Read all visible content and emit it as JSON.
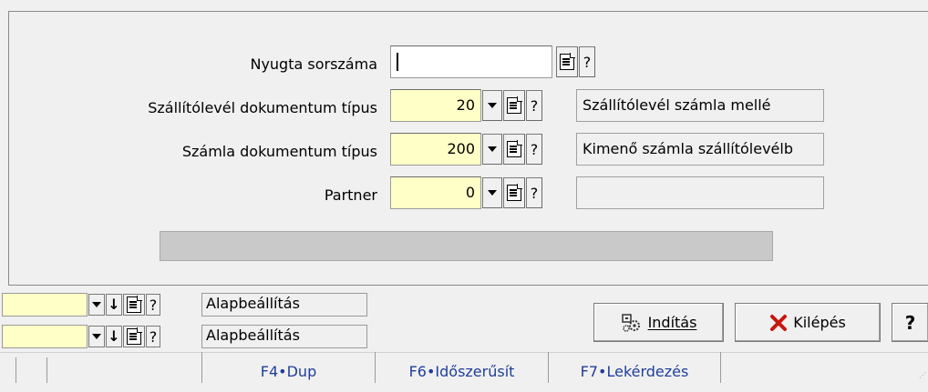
{
  "form": {
    "fields": [
      {
        "label": "Nyugta sorszáma",
        "value": "",
        "description": ""
      },
      {
        "label": "Szállítólevél dokumentum típus",
        "value": "20",
        "description": "Szállítólevél számla mellé"
      },
      {
        "label": "Számla dokumentum típus",
        "value": "200",
        "description": "Kimenő számla szállítólevélb"
      },
      {
        "label": "Partner",
        "value": "0",
        "description": ""
      }
    ],
    "help_glyph": "?"
  },
  "settings_rows": [
    {
      "label": "Alapbeállítás"
    },
    {
      "label": "Alapbeállítás"
    }
  ],
  "buttons": {
    "start_label": "Indítás",
    "exit_label": "Kilépés",
    "help_label": "?"
  },
  "statusbar": {
    "items": [
      "F4•Dup",
      "F6•Időszerűsít",
      "F7•Lekérdezés"
    ]
  }
}
